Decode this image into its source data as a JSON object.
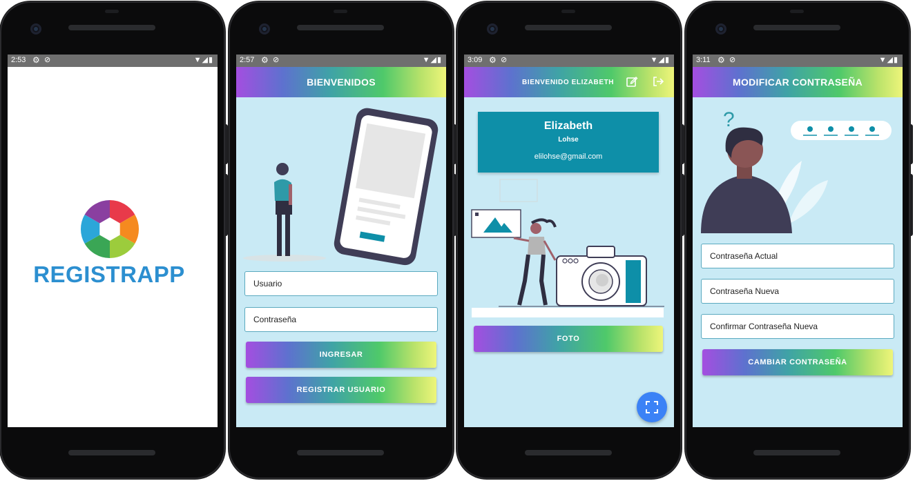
{
  "splash": {
    "status_time": "2:53",
    "logo_text": "REGISTRAPP",
    "colors": {
      "brand": "#2c8fd0",
      "background": "#ffffff"
    }
  },
  "login": {
    "status_time": "2:57",
    "title": "BIENVENIDOS",
    "username_placeholder": "Usuario",
    "password_placeholder": "Contraseña",
    "login_button": "INGRESAR",
    "register_button": "REGISTRAR USUARIO"
  },
  "home": {
    "status_time": "3:09",
    "title": "BIENVENIDO ELIZABETH",
    "header_icons": [
      "edit-icon",
      "logout-icon"
    ],
    "profile": {
      "first_name": "Elizabeth",
      "last_name": "Lohse",
      "email": "elilohse@gmail.com"
    },
    "photo_button": "FOTO",
    "fab_icon": "scan-icon"
  },
  "change_password": {
    "status_time": "3:11",
    "title": "MODIFICAR CONTRASEÑA",
    "current_password_placeholder": "Contraseña Actual",
    "new_password_placeholder": "Contraseña Nueva",
    "confirm_password_placeholder": "Confirmar Contraseña Nueva",
    "submit_button": "CAMBIAR CONTRASEÑA"
  },
  "colors": {
    "screen_bg": "#c9eaf5",
    "card_teal": "#0e8fa8",
    "fab_blue": "#3b82f6"
  }
}
